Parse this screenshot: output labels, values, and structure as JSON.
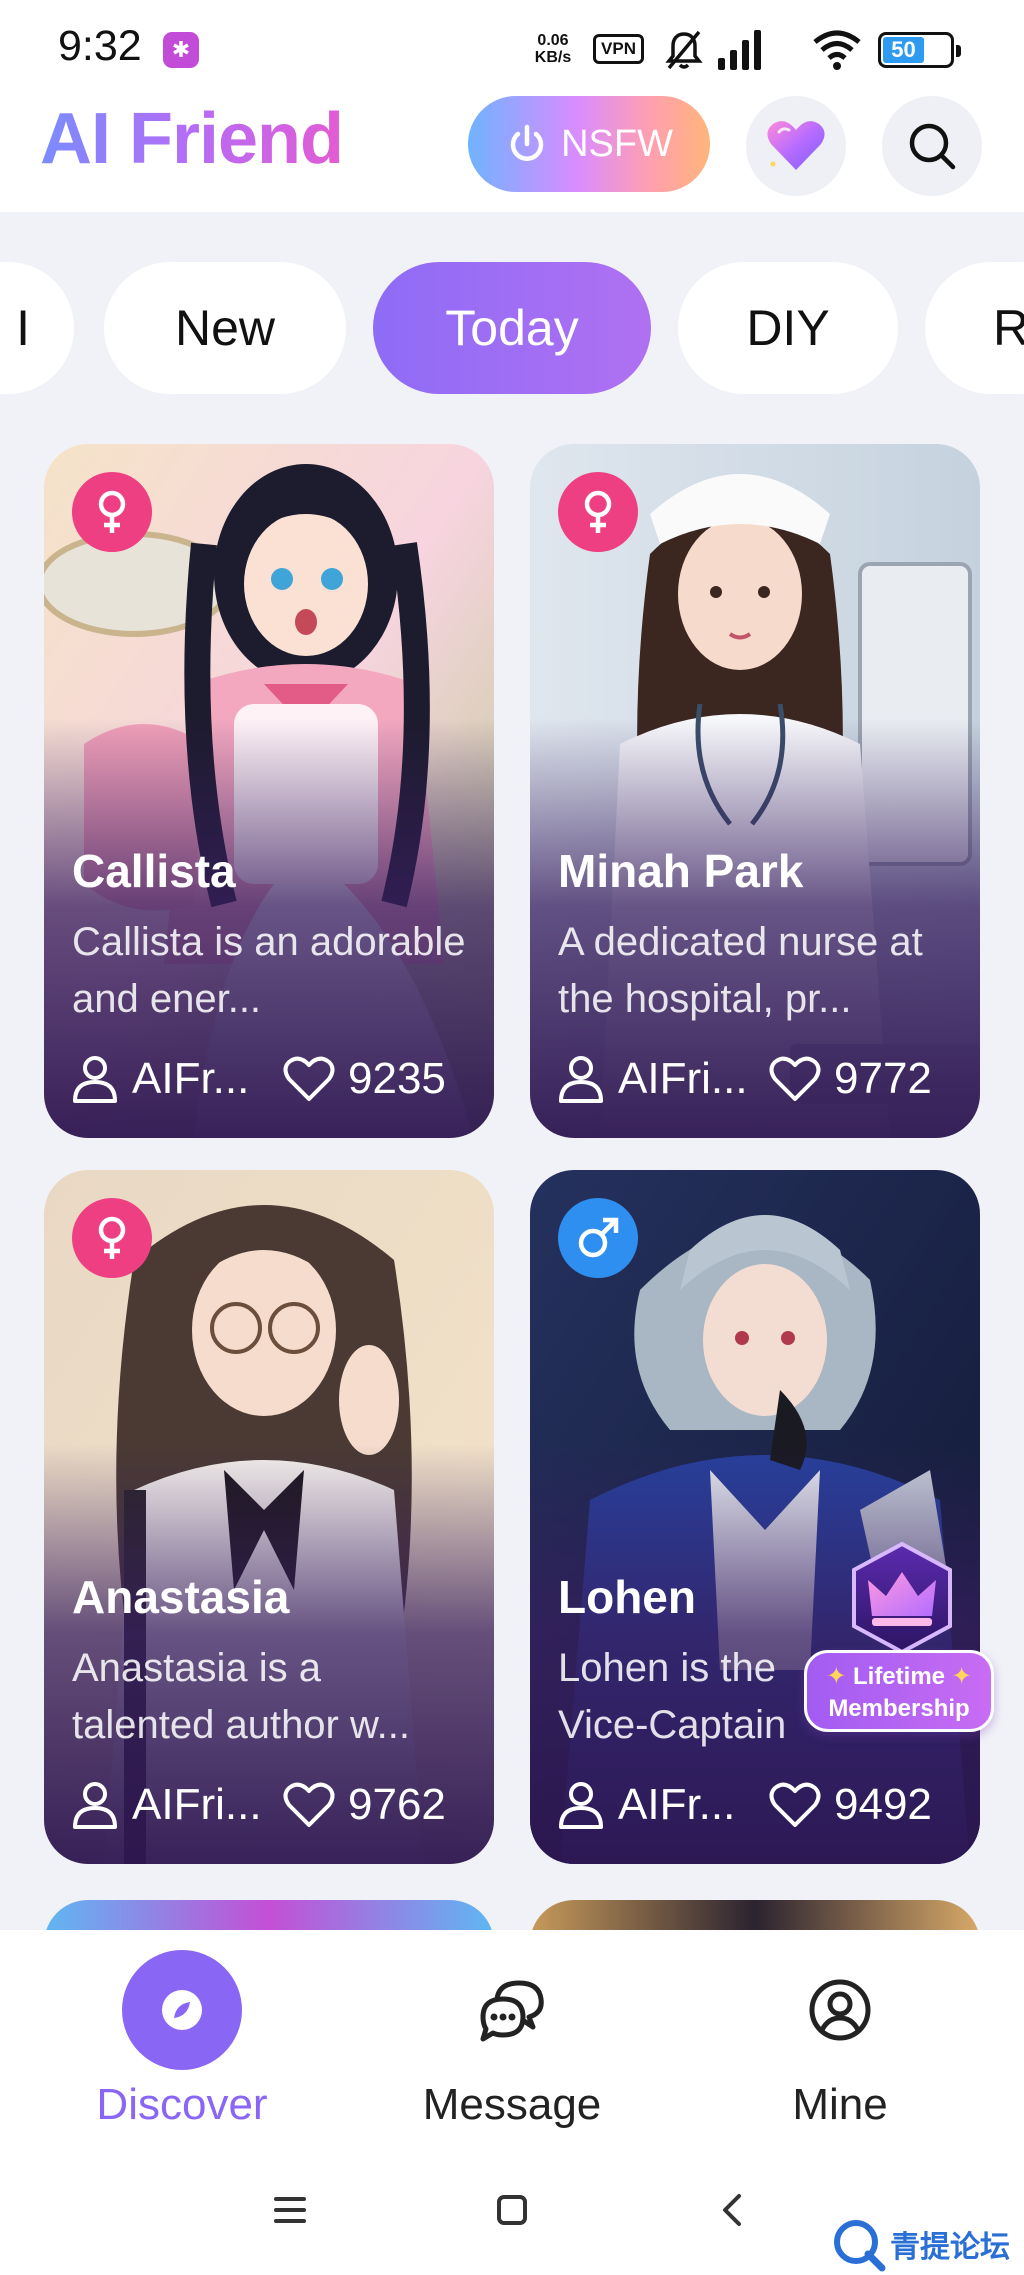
{
  "status_bar": {
    "time": "9:32",
    "network_speed_value": "0.06",
    "network_speed_unit": "KB/s",
    "vpn": "VPN",
    "battery": "50"
  },
  "header": {
    "title": "AI Friend",
    "nsfw_label": "NSFW"
  },
  "tabs": [
    {
      "label": "I"
    },
    {
      "label": "New"
    },
    {
      "label": "Today",
      "active": true
    },
    {
      "label": "DIY"
    },
    {
      "label": "R"
    }
  ],
  "cards": [
    {
      "name": "Callista",
      "gender": "female",
      "description": "Callista is an adorable and ener...",
      "author": "AIFr...",
      "likes": "9235"
    },
    {
      "name": "Minah Park",
      "gender": "female",
      "description": "A dedicated nurse at the hospital, pr...",
      "author": "AIFri...",
      "likes": "9772"
    },
    {
      "name": "Anastasia",
      "gender": "female",
      "description": "Anastasia is a talented author w...",
      "author": "AIFri...",
      "likes": "9762"
    },
    {
      "name": "Lohen",
      "gender": "male",
      "description": "Lohen is the Vice-Captain",
      "author": "AIFr...",
      "likes": "9492"
    }
  ],
  "promo": {
    "line1": "Lifetime",
    "line2": "Membership"
  },
  "bottom_nav": [
    {
      "label": "Discover",
      "active": true
    },
    {
      "label": "Message"
    },
    {
      "label": "Mine"
    }
  ],
  "watermark": "青提论坛",
  "colors": {
    "accent": "#8a66f5",
    "female_badge": "#ee3f82",
    "male_badge": "#2f8ff0",
    "background": "#f1f2f7"
  }
}
